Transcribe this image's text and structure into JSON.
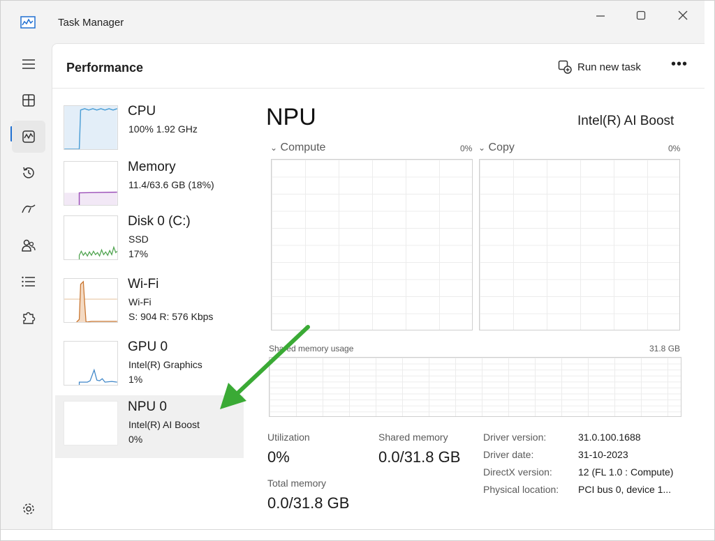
{
  "window": {
    "title": "Task Manager"
  },
  "header": {
    "title": "Performance",
    "run_new_task": "Run new task",
    "more": "•••"
  },
  "devices": [
    {
      "name": "CPU",
      "line1": "100%  1.92 GHz",
      "line2": ""
    },
    {
      "name": "Memory",
      "line1": "11.4/63.6 GB (18%)",
      "line2": ""
    },
    {
      "name": "Disk 0 (C:)",
      "line1": "SSD",
      "line2": "17%"
    },
    {
      "name": "Wi-Fi",
      "line1": "Wi-Fi",
      "line2": "S: 904  R: 576 Kbps"
    },
    {
      "name": "GPU 0",
      "line1": "Intel(R) Graphics",
      "line2": "1%"
    },
    {
      "name": "NPU 0",
      "line1": "Intel(R) AI Boost",
      "line2": "0%"
    }
  ],
  "detail": {
    "title": "NPU",
    "model": "Intel(R) AI Boost",
    "graphs": [
      {
        "label": "Compute",
        "value": "0%"
      },
      {
        "label": "Copy",
        "value": "0%"
      }
    ],
    "shared_memory_label": "Shared memory usage",
    "shared_memory_max": "31.8 GB",
    "stats": {
      "utilization_label": "Utilization",
      "utilization_value": "0%",
      "shared_memory_label": "Shared memory",
      "shared_memory_value": "0.0/31.8 GB",
      "total_memory_label": "Total memory",
      "total_memory_value": "0.0/31.8 GB"
    },
    "info": [
      {
        "label": "Driver version:",
        "value": "31.0.100.1688"
      },
      {
        "label": "Driver date:",
        "value": "31-10-2023"
      },
      {
        "label": "DirectX version:",
        "value": "12 (FL 1.0 : Compute)"
      },
      {
        "label": "Physical location:",
        "value": "PCI bus 0, device 1..."
      }
    ]
  },
  "colors": {
    "cpu": "#4d9fd6",
    "memory": "#9b4fb8",
    "disk": "#4fa34f",
    "wifi": "#c8742e",
    "gpu": "#3e86c8",
    "arrow": "#3aaa35",
    "accent": "#1f6fd1"
  }
}
